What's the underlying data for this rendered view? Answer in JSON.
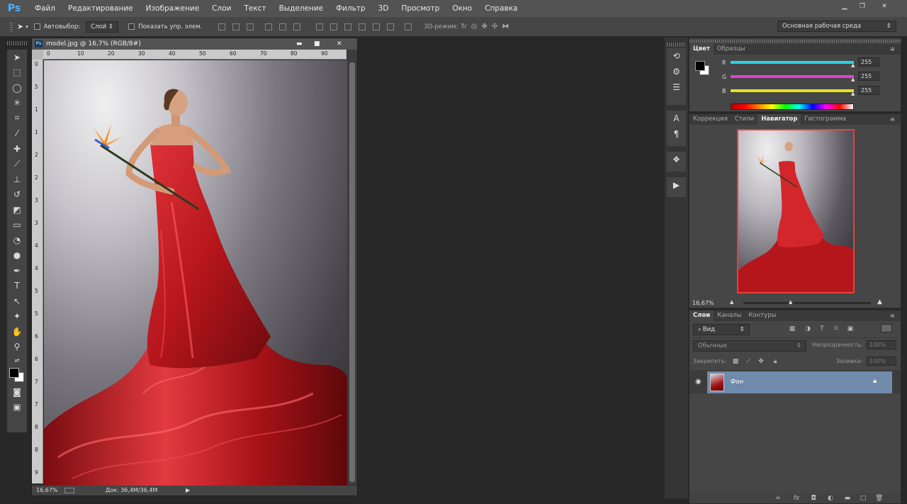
{
  "app": {
    "logo": "Ps"
  },
  "menu": [
    "Файл",
    "Редактирование",
    "Изображение",
    "Слои",
    "Текст",
    "Выделение",
    "Фильтр",
    "3D",
    "Просмотр",
    "Окно",
    "Справка"
  ],
  "options": {
    "auto_select_label": "Автовыбор:",
    "auto_select_value": "Слой",
    "show_controls_label": "Показать упр. элем.",
    "mode3d_label": "3D-режим:",
    "workspace": "Основная рабочая среда"
  },
  "document": {
    "title": "model.jpg @ 16,7% (RGB/8#)",
    "zoom": "16,67%",
    "doc_size": "Док: 36,4M/36,4M",
    "ruler_x": [
      "0",
      "10",
      "20",
      "30",
      "40",
      "50",
      "60",
      "70",
      "80",
      "90"
    ],
    "ruler_y": [
      "0",
      "5",
      "1",
      "1",
      "2",
      "2",
      "3",
      "3",
      "4",
      "4",
      "5",
      "5",
      "6",
      "6",
      "7",
      "7",
      "8",
      "8",
      "9"
    ]
  },
  "color_panel": {
    "tabs": [
      "Цвет",
      "Образцы"
    ],
    "channels": [
      {
        "label": "R",
        "value": "255",
        "color": "#2ad3e6"
      },
      {
        "label": "G",
        "value": "255",
        "color": "#e040d8"
      },
      {
        "label": "B",
        "value": "255",
        "color": "#e8e020"
      }
    ]
  },
  "navigator_panel": {
    "tabs": [
      "Коррекция",
      "Стили",
      "Навигатор",
      "Гистограмма"
    ],
    "zoom": "16,67%"
  },
  "layers_panel": {
    "tabs": [
      "Слои",
      "Каналы",
      "Контуры"
    ],
    "filter": "Вид",
    "blend_mode": "Обычные",
    "opacity_label": "Непрозрачность:",
    "opacity_value": "100%",
    "lock_label": "Закрепить:",
    "fill_label": "Заливка:",
    "fill_value": "100%",
    "layers": [
      {
        "name": "Фон",
        "locked": true,
        "visible": true
      }
    ]
  },
  "colors": {
    "accent": "#4fb0ff",
    "layer_selected": "#6f8aaa",
    "dress": "#c41a1e"
  }
}
